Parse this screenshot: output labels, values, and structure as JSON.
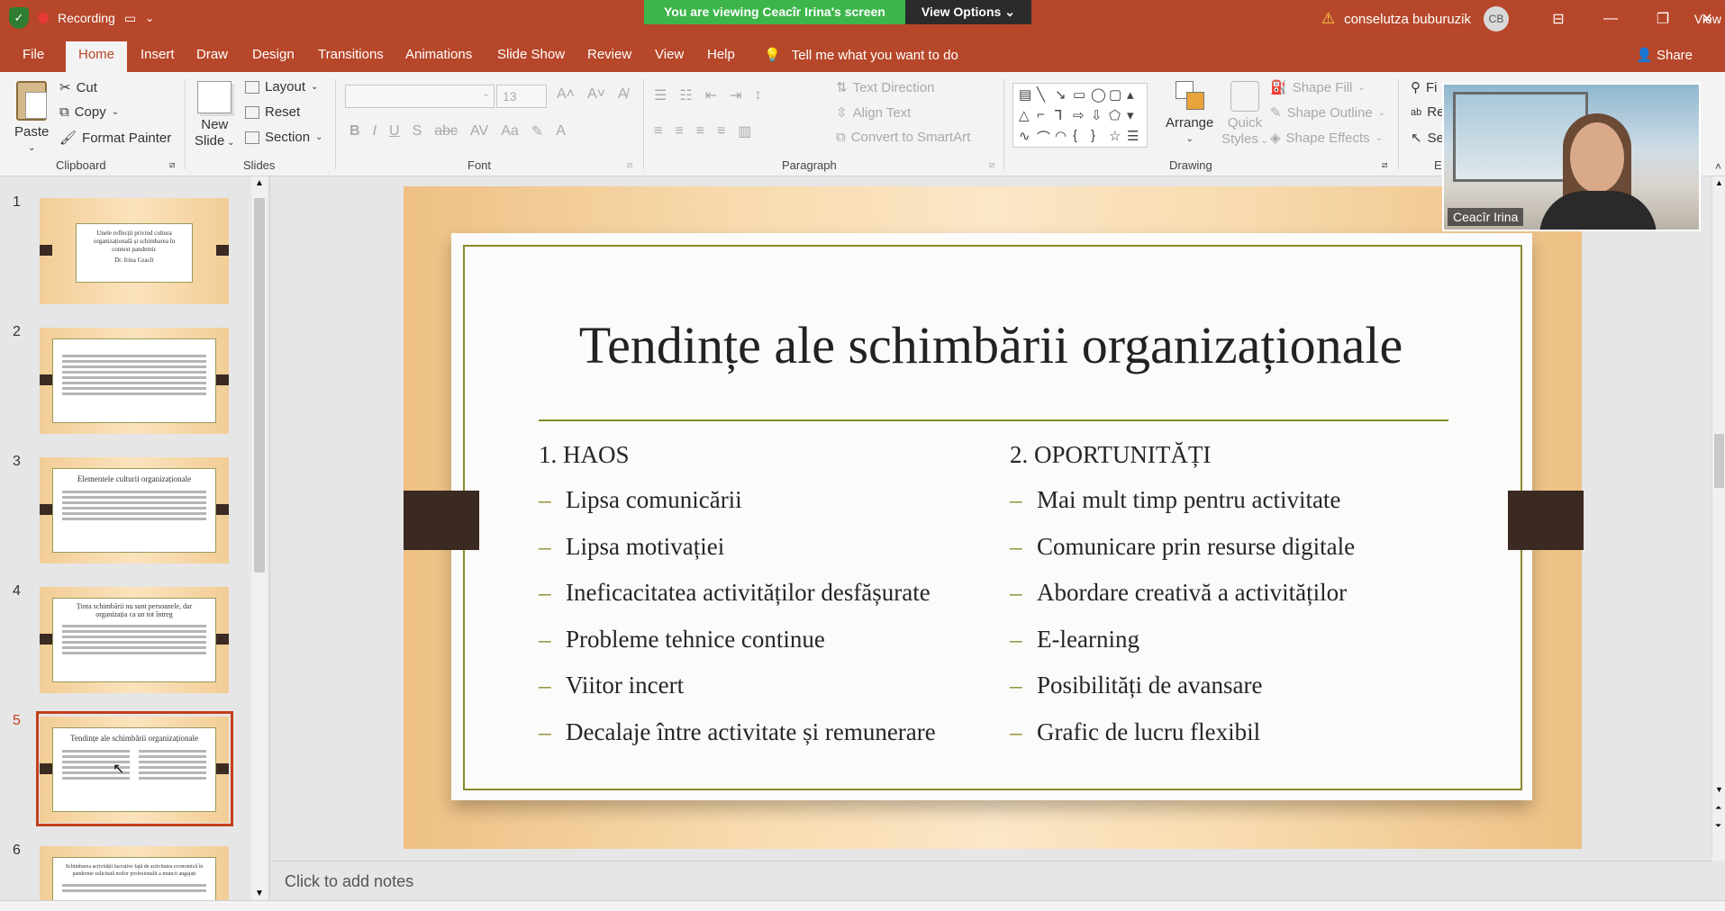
{
  "titlebar": {
    "recording_label": "Recording",
    "share_banner": "You are viewing Ceacîr Irina's screen",
    "view_options": "View Options",
    "user_name": "conselutza buburuzik",
    "user_initials": "CB",
    "view_label": "View",
    "accent_color": "#b7472a",
    "banner_color": "#3cb64a"
  },
  "menu": {
    "file": "File",
    "home": "Home",
    "insert": "Insert",
    "draw": "Draw",
    "design": "Design",
    "transitions": "Transitions",
    "animations": "Animations",
    "slide_show": "Slide Show",
    "review": "Review",
    "view": "View",
    "help": "Help",
    "tell_me": "Tell me what you want to do",
    "share": "Share"
  },
  "ribbon": {
    "clipboard": {
      "paste": "Paste",
      "cut": "Cut",
      "copy": "Copy",
      "format_painter": "Format Painter",
      "label": "Clipboard"
    },
    "slides": {
      "new_slide_line1": "New",
      "new_slide_line2": "Slide",
      "layout": "Layout",
      "reset": "Reset",
      "section": "Section",
      "label": "Slides"
    },
    "font": {
      "size": "13",
      "label": "Font"
    },
    "paragraph": {
      "text_direction": "Text Direction",
      "align_text": "Align Text",
      "convert_smartart": "Convert to SmartArt",
      "label": "Paragraph"
    },
    "drawing": {
      "arrange": "Arrange",
      "quick_styles_line1": "Quick",
      "quick_styles_line2": "Styles",
      "shape_fill": "Shape Fill",
      "shape_outline": "Shape Outline",
      "shape_effects": "Shape Effects",
      "label": "Drawing"
    },
    "editing": {
      "find": "Fi",
      "replace": "Re",
      "select": "Se",
      "label": "E"
    }
  },
  "thumbnails": [
    {
      "num": "1",
      "title": "Unele reflecții privind cultura organizațională și schimbarea în context pandemic",
      "sub": "Dr. Irina Ceacîr"
    },
    {
      "num": "2",
      "title": "",
      "sub": ""
    },
    {
      "num": "3",
      "title": "Elementele culturii organizaționale",
      "sub": ""
    },
    {
      "num": "4",
      "title": "Ținta schimbării nu sunt persoanele, dar organizația ca un tot întreg",
      "sub": ""
    },
    {
      "num": "5",
      "title": "Tendințe ale schimbării organizaționale",
      "sub": ""
    },
    {
      "num": "6",
      "title": "Schimbarea activității lucrative față de activitatea economică în pandemie solicitată noilor profesionalii a muncii angajați",
      "sub": ""
    }
  ],
  "slide": {
    "title": "Tendințe ale schimbării organizaționale",
    "left_heading": "1. HAOS",
    "left_items": [
      "Lipsa comunicării",
      "Lipsa motivației",
      "Ineficacitatea activităților desfășurate",
      "Probleme tehnice continue",
      "Viitor incert",
      "Decalaje între activitate și remunerare"
    ],
    "right_heading": "2. OPORTUNITĂȚI",
    "right_items": [
      "Mai mult timp pentru activitate",
      "Comunicare prin resurse digitale",
      "Abordare creativă a activităților",
      "E-learning",
      "Posibilități de avansare",
      "Grafic de lucru flexibil"
    ]
  },
  "notes": {
    "placeholder": "Click to add notes"
  },
  "webcam": {
    "name": "Ceacîr Irina"
  }
}
